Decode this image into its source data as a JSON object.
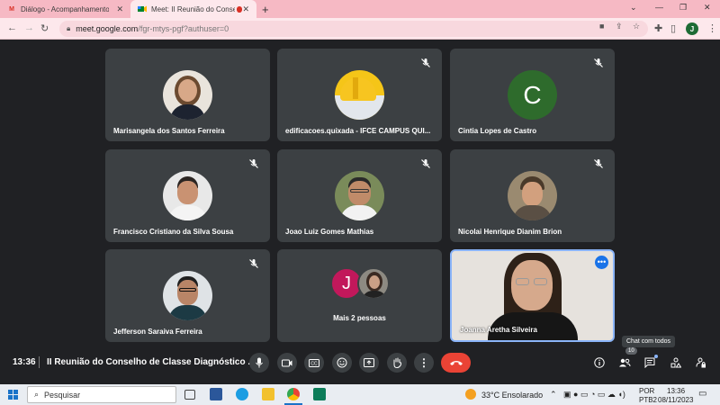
{
  "browser": {
    "tabs": [
      {
        "title": "Diálogo - Acompanhamento pe",
        "close": "✕"
      },
      {
        "title": "Meet: II Reunião do Conselh",
        "close": "✕"
      }
    ],
    "new_tab": "+",
    "url_host": "meet.google.com",
    "url_path": "/fgr-mtys-pgf?authuser=0",
    "profile_initial": "J"
  },
  "participants": [
    {
      "name": "Marisangela dos Santos Ferreira",
      "muted": false
    },
    {
      "name": "edificacoes.quixada - IFCE CAMPUS QUI...",
      "muted": true
    },
    {
      "name": "Cintia Lopes de Castro",
      "muted": true,
      "initial": "C"
    },
    {
      "name": "Francisco Cristiano da Silva Sousa",
      "muted": true
    },
    {
      "name": "Joao Luiz Gomes Mathias",
      "muted": true
    },
    {
      "name": "Nicolai Henrique Dianim Brion",
      "muted": true
    },
    {
      "name": "Jefferson Saraiva Ferreira",
      "muted": true
    },
    {
      "name": "Mais 2 pessoas",
      "initial": "J"
    },
    {
      "name": "Joanna Aretha Silveira",
      "muted": false
    }
  ],
  "meeting": {
    "time": "13:36",
    "title": "II Reunião do Conselho de Classe Diagnóstico ...",
    "tooltip": "Chat com todos",
    "people_count": "10"
  },
  "taskbar": {
    "search_placeholder": "Pesquisar",
    "weather": "33°C  Ensolarado",
    "lang1": "POR",
    "lang2": "PTB2",
    "clock_time": "13:36",
    "clock_date": "08/11/2023"
  },
  "colors": {
    "meet_bg": "#202124",
    "tile_bg": "#3c4043",
    "end_call": "#ea4335",
    "accent_blue": "#8ab4f8",
    "tab_strip": "#f6b9c4"
  }
}
